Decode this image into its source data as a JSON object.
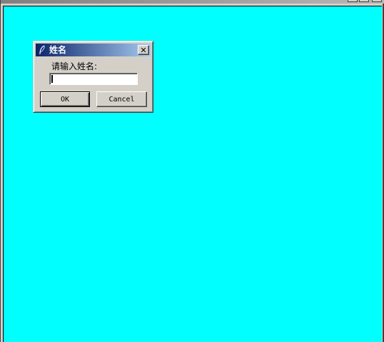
{
  "main_window": {
    "title": "",
    "client_background": "#00ffff"
  },
  "dialog": {
    "title": "姓名",
    "icon": "feather-icon",
    "close_label": "✕",
    "prompt": "请输入姓名:",
    "input_value": "",
    "ok_label": "OK",
    "cancel_label": "Cancel",
    "title_gradient": [
      "#0a246a",
      "#a6caf0"
    ]
  }
}
